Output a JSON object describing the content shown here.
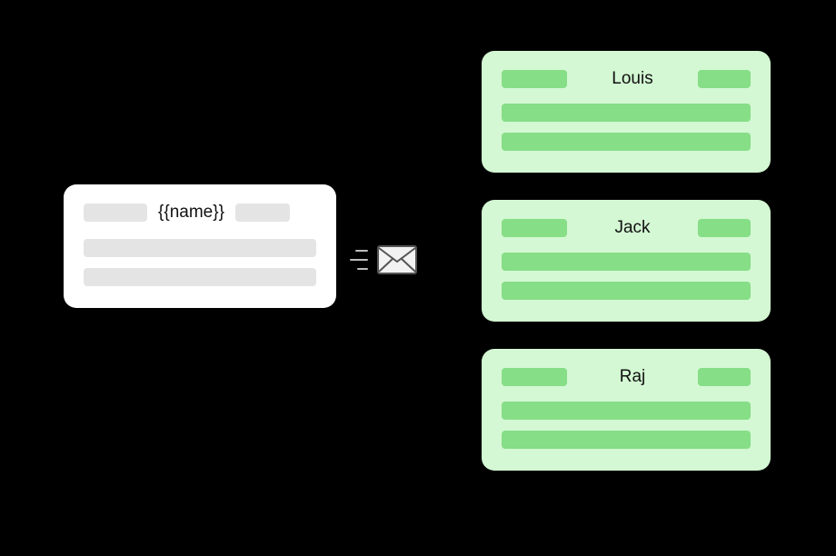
{
  "template": {
    "placeholder": "{{name}}"
  },
  "icon": {
    "name": "mail-icon"
  },
  "recipients": [
    {
      "name": "Louis"
    },
    {
      "name": "Jack"
    },
    {
      "name": "Raj"
    }
  ]
}
